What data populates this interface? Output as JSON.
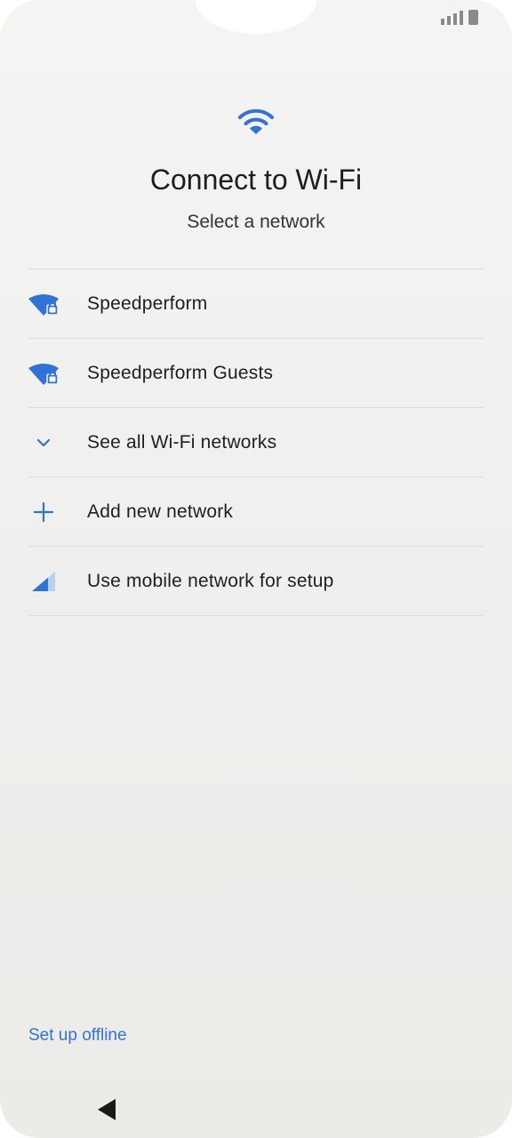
{
  "header": {
    "title": "Connect to Wi-Fi",
    "subtitle": "Select a network"
  },
  "networks": [
    {
      "label": "Speedperform",
      "icon": "wifi-lock-icon"
    },
    {
      "label": "Speedperform Guests",
      "icon": "wifi-lock-icon"
    }
  ],
  "actions": [
    {
      "label": "See all Wi-Fi networks",
      "icon": "chevron-down-icon"
    },
    {
      "label": "Add new network",
      "icon": "plus-icon"
    },
    {
      "label": "Use mobile network for setup",
      "icon": "cellular-signal-icon"
    }
  ],
  "footer": {
    "offline_label": "Set up offline"
  },
  "colors": {
    "accent": "#2f73d9",
    "accent_light": "#b7cff3"
  }
}
